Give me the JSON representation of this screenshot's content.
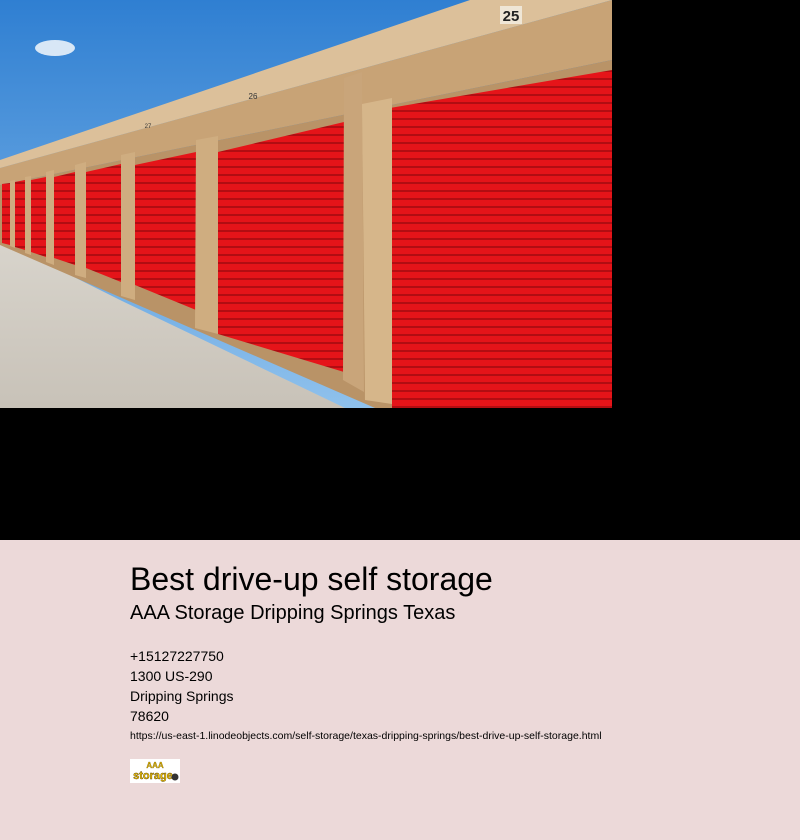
{
  "hero": {
    "image_description_icon": "storage-units-photo",
    "unit_numbers": [
      "25",
      "26",
      "27"
    ]
  },
  "business": {
    "title": "Best drive-up self storage",
    "name": "AAA Storage Dripping Springs Texas",
    "phone": "+15127227750",
    "street": "1300 US-290",
    "city": "Dripping Springs",
    "zip": "78620",
    "url": "https://us-east-1.linodeobjects.com/self-storage/texas-dripping-springs/best-drive-up-self-storage.html",
    "logo_text": "AAA storage"
  },
  "colors": {
    "background_band": "#ecd9d9",
    "door_red": "#e8141a",
    "wall_tan": "#c9a57a",
    "sky": "#4f93d8"
  }
}
